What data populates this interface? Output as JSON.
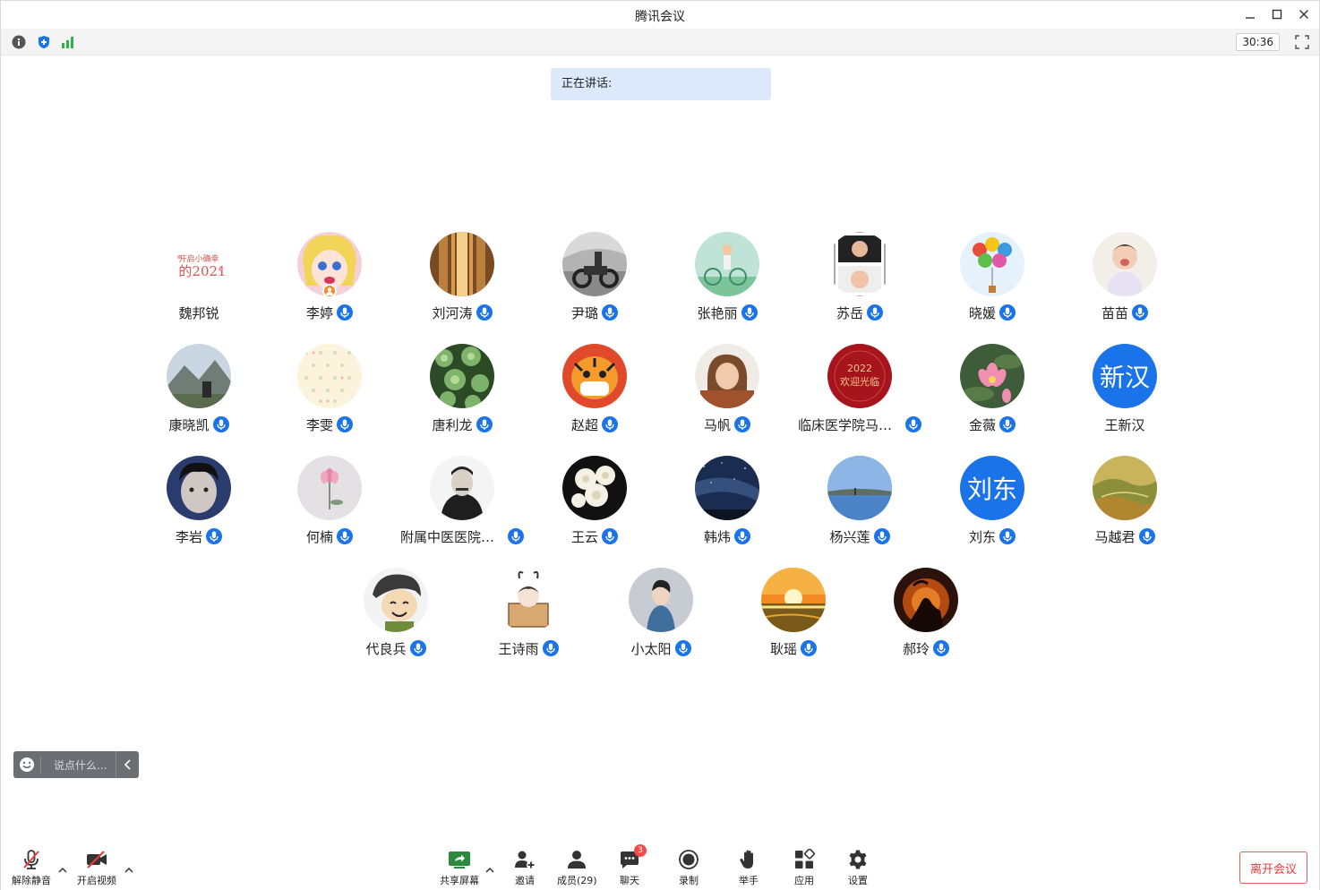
{
  "window": {
    "title": "腾讯会议"
  },
  "toolbar": {
    "timer": "30:36"
  },
  "speaking": {
    "label": "正在讲话:"
  },
  "participants": [
    {
      "name": "魏邦锐",
      "mic": false,
      "avatar": "text-card"
    },
    {
      "name": "李婷",
      "mic": true,
      "host": true,
      "avatar": "cartoon"
    },
    {
      "name": "刘河涛",
      "mic": true,
      "avatar": "corridor"
    },
    {
      "name": "尹璐",
      "mic": true,
      "avatar": "motorbike"
    },
    {
      "name": "张艳丽",
      "mic": true,
      "avatar": "bicycle"
    },
    {
      "name": "苏岳",
      "mic": true,
      "avatar": "baby-square"
    },
    {
      "name": "晓媛",
      "mic": true,
      "avatar": "balloons"
    },
    {
      "name": "苗苗",
      "mic": true,
      "avatar": "child"
    },
    {
      "name": "康晓凯",
      "mic": true,
      "avatar": "mountain"
    },
    {
      "name": "李雯",
      "mic": true,
      "avatar": "dots"
    },
    {
      "name": "唐利龙",
      "mic": true,
      "avatar": "plants"
    },
    {
      "name": "赵超",
      "mic": true,
      "avatar": "tiger"
    },
    {
      "name": "马帆",
      "mic": true,
      "avatar": "girl"
    },
    {
      "name": "临床医学院马宝立",
      "mic": true,
      "avatar": "red-card",
      "avatar_text": "2022 欢迎光临"
    },
    {
      "name": "金薇",
      "mic": true,
      "avatar": "lotus"
    },
    {
      "name": "王新汉",
      "mic": false,
      "avatar": "initials",
      "initials": "新汉"
    },
    {
      "name": "李岩",
      "mic": true,
      "avatar": "face"
    },
    {
      "name": "何楠",
      "mic": true,
      "avatar": "flower-gray"
    },
    {
      "name": "附属中医医院康...",
      "mic": true,
      "avatar": "portrait"
    },
    {
      "name": "王云",
      "mic": true,
      "avatar": "white-flowers"
    },
    {
      "name": "韩炜",
      "mic": true,
      "avatar": "night-sky"
    },
    {
      "name": "杨兴莲",
      "mic": true,
      "avatar": "lake"
    },
    {
      "name": "刘东",
      "mic": true,
      "avatar": "initials",
      "initials": "刘东"
    },
    {
      "name": "马越君",
      "mic": true,
      "avatar": "hills"
    },
    {
      "name": "代良兵",
      "mic": true,
      "avatar": "cartoon-boy"
    },
    {
      "name": "王诗雨",
      "mic": true,
      "avatar": "box-cartoon"
    },
    {
      "name": "小太阳",
      "mic": true,
      "avatar": "boy-blue"
    },
    {
      "name": "耿瑶",
      "mic": true,
      "avatar": "sunset"
    },
    {
      "name": "郝玲",
      "mic": true,
      "avatar": "silhouette"
    }
  ],
  "chat": {
    "placeholder": "说点什么..."
  },
  "bottombar": {
    "mute": "解除静音",
    "video": "开启视频",
    "share": "共享屏幕",
    "invite": "邀请",
    "members": "成员(29)",
    "chat": "聊天",
    "chat_badge": "3",
    "record": "录制",
    "raise_hand": "举手",
    "apps": "应用",
    "settings": "设置",
    "leave": "离开会议"
  },
  "colors": {
    "accent": "#1a73e8",
    "leave": "#e23c3c",
    "speaking_bg": "#dbe9fb"
  }
}
